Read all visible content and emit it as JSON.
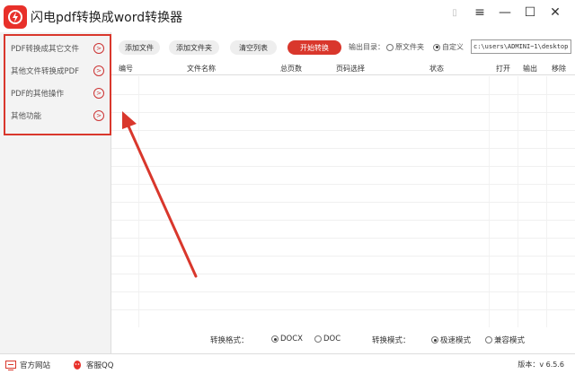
{
  "app": {
    "title": "闪电pdf转换成word转换器"
  },
  "window_buttons": {
    "settings": "⚙",
    "menu": "≡",
    "minimize": "—",
    "maximize": "☐",
    "close": "✕"
  },
  "sidebar": {
    "items": [
      {
        "label": "PDF转换成其它文件"
      },
      {
        "label": "其他文件转换成PDF"
      },
      {
        "label": "PDF的其他操作"
      },
      {
        "label": "其他功能"
      }
    ]
  },
  "toolbar": {
    "add_file": "添加文件",
    "add_folder": "添加文件夹",
    "clear_list": "清空列表",
    "start": "开始转换",
    "output_dir_label": "输出目录：",
    "original_folder": "原文件夹",
    "custom": "自定义",
    "path_value": "c:\\users\\ADMINI~1\\desktop"
  },
  "table": {
    "headers": [
      "编号",
      "文件名称",
      "总页数",
      "页码选择",
      "状态",
      "打开",
      "输出",
      "移除"
    ]
  },
  "options": {
    "format_label": "转换格式：",
    "format_docx": "DOCX",
    "format_doc": "DOC",
    "mode_label": "转换模式：",
    "mode_fast": "极速模式",
    "mode_compat": "兼容模式"
  },
  "statusbar": {
    "website": "官方网站",
    "qq": "客服QQ",
    "version": "版本：v 6.5.6"
  },
  "colors": {
    "accent": "#d9372c"
  }
}
